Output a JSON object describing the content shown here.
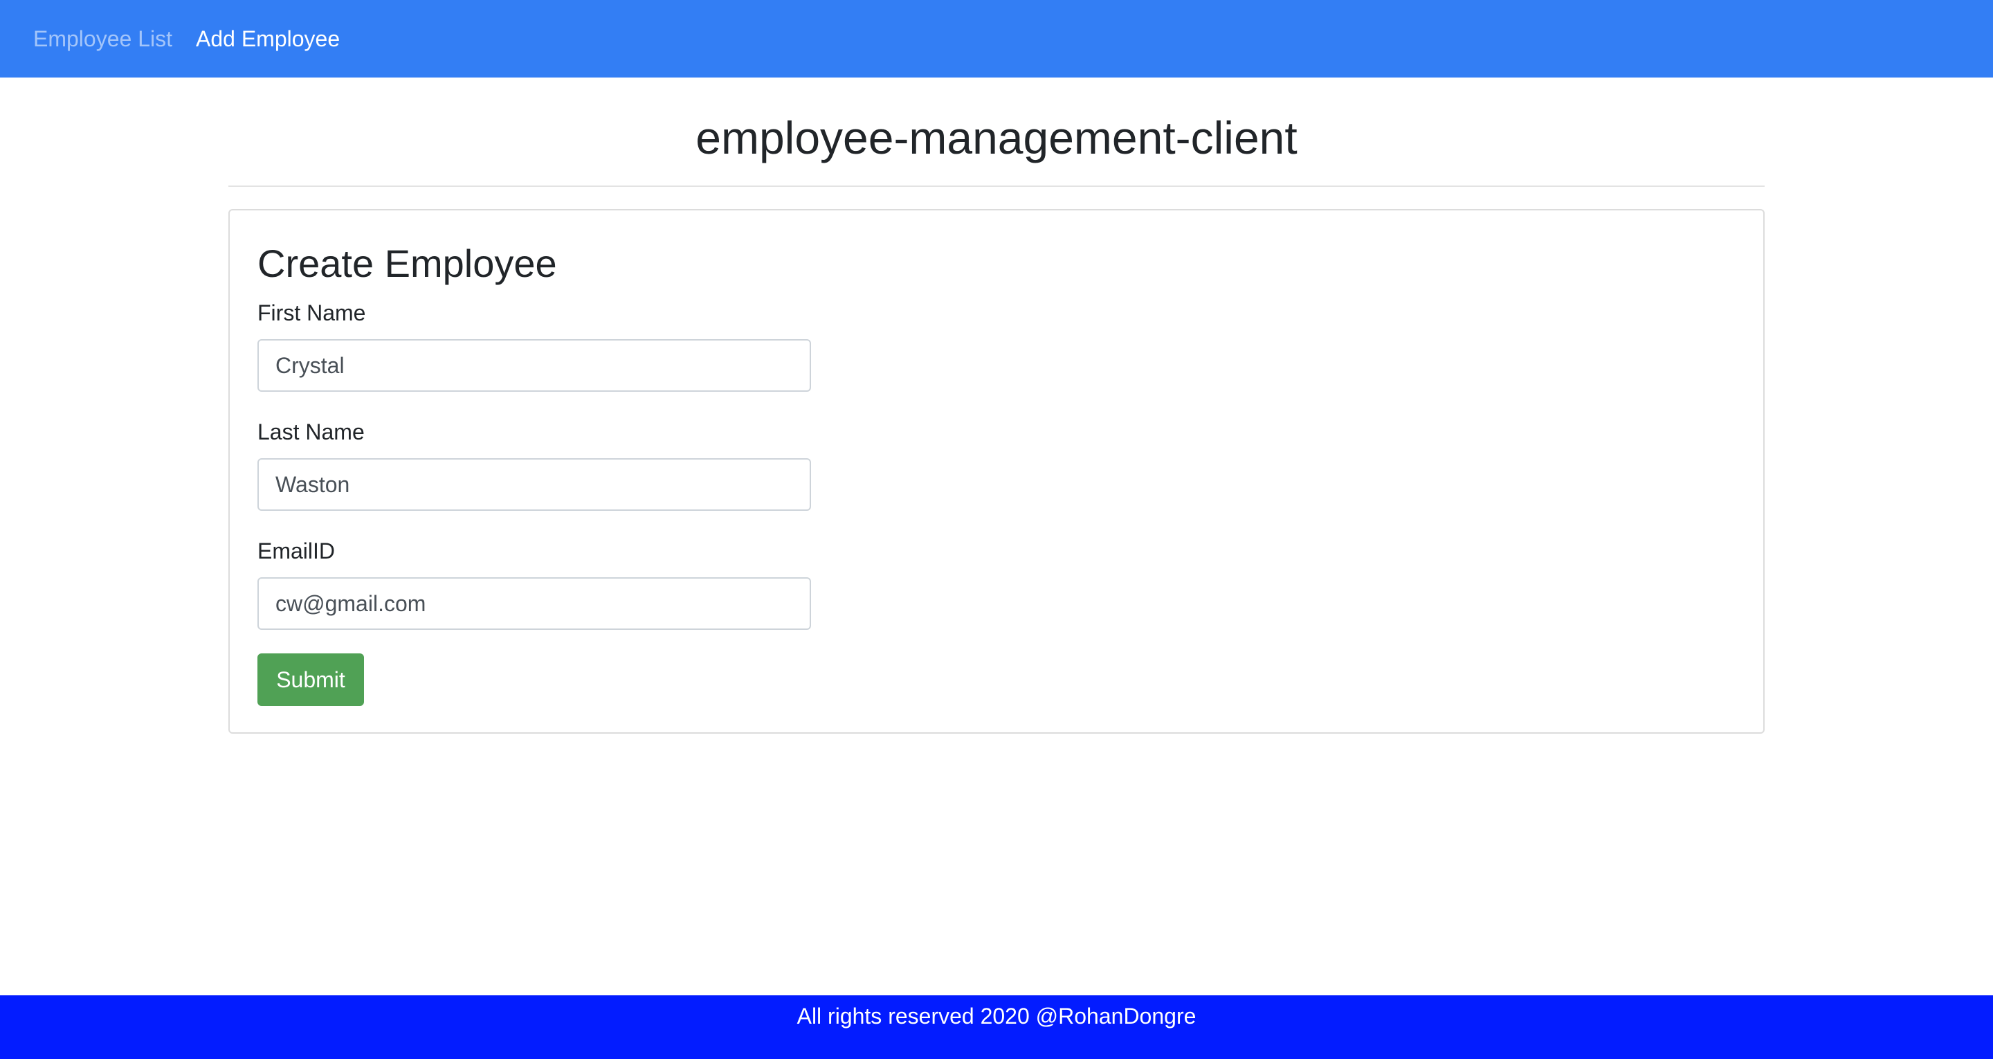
{
  "navbar": {
    "links": [
      {
        "label": "Employee List",
        "active": false
      },
      {
        "label": "Add Employee",
        "active": true
      }
    ],
    "background": "#337ef4"
  },
  "page": {
    "title": "employee-management-client"
  },
  "form": {
    "title": "Create Employee",
    "fields": [
      {
        "label": "First Name",
        "value": "Crystal"
      },
      {
        "label": "Last Name",
        "value": "Waston"
      },
      {
        "label": "EmailID",
        "value": "cw@gmail.com"
      }
    ],
    "submit_label": "Submit",
    "submit_color": "#50a155"
  },
  "footer": {
    "text": "All rights reserved 2020 @RohanDongre",
    "background": "#031cff"
  }
}
